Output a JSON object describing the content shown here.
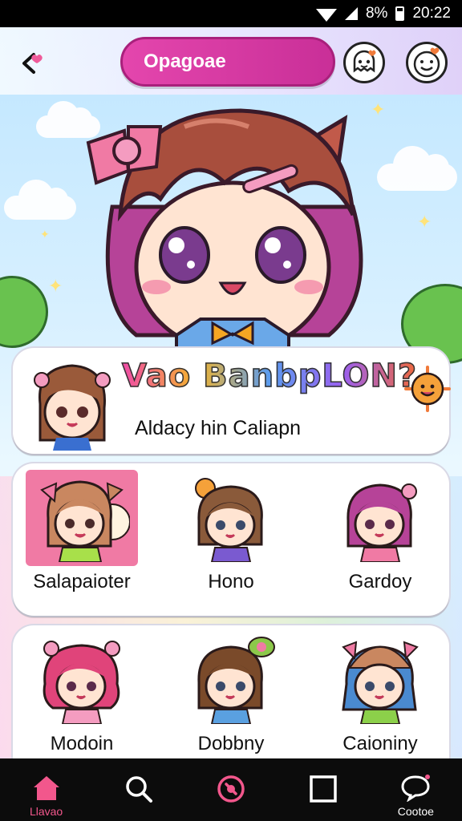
{
  "status_bar": {
    "battery": "8%",
    "time": "20:22"
  },
  "header": {
    "title": "Opagoae"
  },
  "banner": {
    "title": "Vao BanbpLON?",
    "subtitle": "Aldacy hin Caliapn"
  },
  "characters_row1": [
    {
      "name": "Salapaioter",
      "selected": true
    },
    {
      "name": "Hono",
      "selected": false
    },
    {
      "name": "Gardoy",
      "selected": false
    }
  ],
  "characters_row2": [
    {
      "name": "Modoin"
    },
    {
      "name": "Dobbny"
    },
    {
      "name": "Caioniny"
    }
  ],
  "nav": [
    {
      "label": "Llavao",
      "icon": "home-icon",
      "active": true
    },
    {
      "label": "",
      "icon": "search-icon",
      "active": false
    },
    {
      "label": "",
      "icon": "record-icon",
      "active": false
    },
    {
      "label": "",
      "icon": "square-icon",
      "active": false
    },
    {
      "label": "Cootoe",
      "icon": "chat-bubble-icon",
      "active": false
    }
  ],
  "colors": {
    "accent": "#e446ad",
    "nav_active": "#f2578c",
    "nav_bg": "#0c0c0c"
  }
}
